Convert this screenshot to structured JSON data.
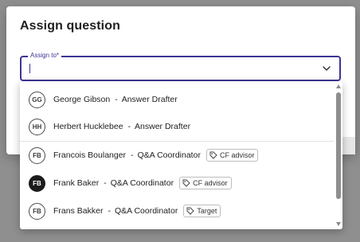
{
  "dialog": {
    "title": "Assign question"
  },
  "assign_field": {
    "label": "Assign to*",
    "value": ""
  },
  "options": [
    {
      "initials": "GG",
      "name": "George Gibson",
      "separator": "-",
      "role": "Answer Drafter",
      "tag": null,
      "selected": false
    },
    {
      "initials": "HH",
      "name": "Herbert Hucklebee",
      "separator": "-",
      "role": "Answer Drafter",
      "tag": null,
      "selected": false
    },
    {
      "initials": "FB",
      "name": "Francois Boulanger",
      "separator": "-",
      "role": "Q&A Coordinator",
      "tag": "CF advisor",
      "selected": false
    },
    {
      "initials": "FB",
      "name": "Frank Baker",
      "separator": "-",
      "role": "Q&A Coordinator",
      "tag": "CF advisor",
      "selected": true
    },
    {
      "initials": "FB",
      "name": "Frans Bakker",
      "separator": "-",
      "role": "Q&A Coordinator",
      "tag": "Target",
      "selected": false
    }
  ],
  "icons": {
    "dropdown": "chevron-down-icon",
    "tag": "tag-icon"
  },
  "colors": {
    "accent": "#3c3494",
    "backdrop": "#8f8f8f",
    "selected_avatar": "#1c1c1c"
  }
}
